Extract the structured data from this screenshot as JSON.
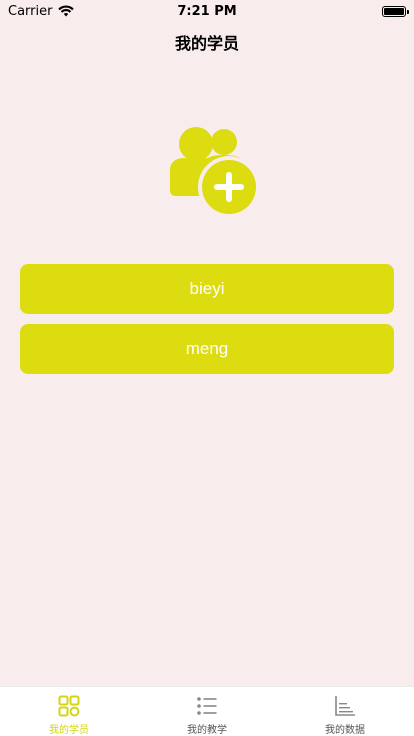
{
  "status_bar": {
    "carrier": "Carrier",
    "time": "7:21 PM",
    "wifi_icon": "wifi-icon",
    "battery_icon": "battery-icon"
  },
  "nav": {
    "title": "我的学员"
  },
  "illustration": {
    "icon": "add-user-group-icon",
    "color": "#dcdc11"
  },
  "students": [
    {
      "name": "bieyi"
    },
    {
      "name": "meng"
    }
  ],
  "tab_bar": {
    "accent_color": "#d4d411",
    "tabs": [
      {
        "label": "我的学员",
        "icon": "grid-icon",
        "active": true
      },
      {
        "label": "我的教学",
        "icon": "list-icon",
        "active": false
      },
      {
        "label": "我的数据",
        "icon": "chart-icon",
        "active": false
      }
    ]
  }
}
